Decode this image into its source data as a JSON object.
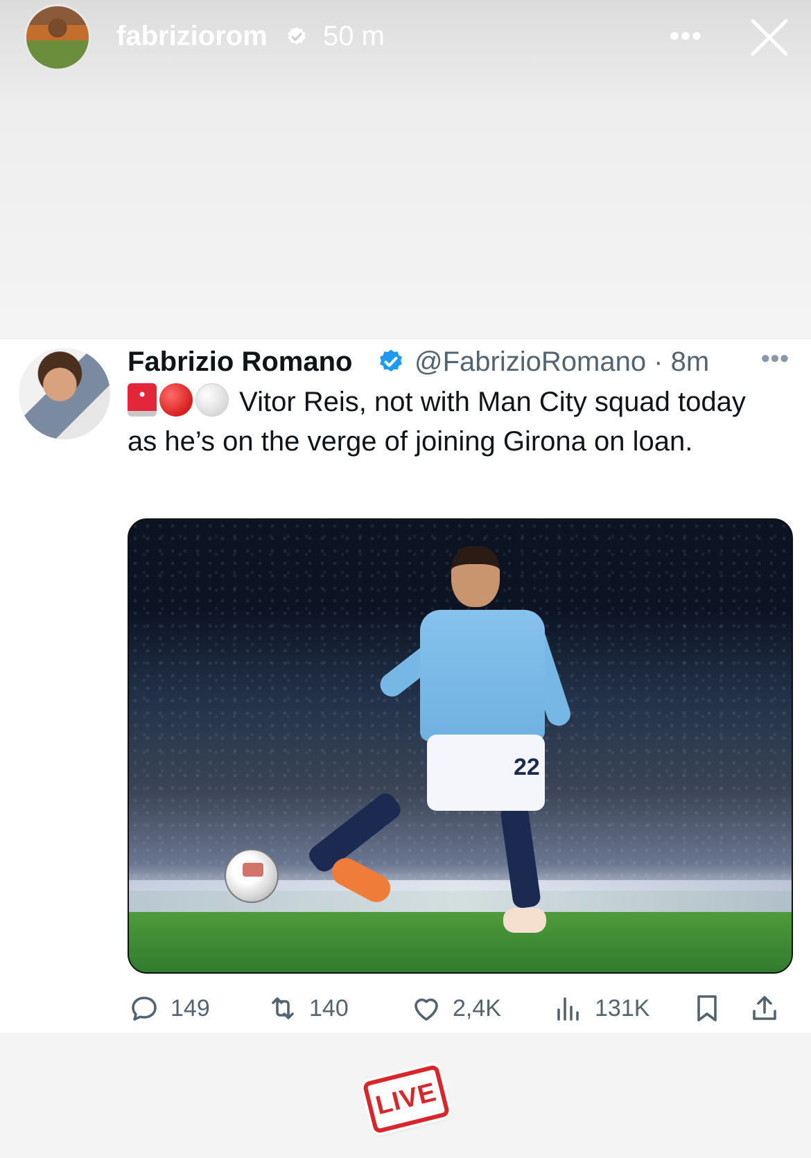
{
  "story": {
    "username": "fabriziorom",
    "time": "50 m",
    "more": "•••"
  },
  "tweet": {
    "author_name": "Fabrizio Romano",
    "handle_time": "@FabrizioRomano · 8m",
    "more": "•••",
    "text": "Vitor Reis, not with Man City squad today as he’s on the verge of joining Girona on loan.",
    "emojis": [
      "siren-emoji",
      "red-circle-emoji",
      "white-circle-emoji"
    ],
    "media": {
      "jersey_number": "22"
    },
    "actions": {
      "replies": "149",
      "reposts": "140",
      "likes": "2,4K",
      "views": "131K"
    }
  },
  "sticker": {
    "label": "LIVE"
  },
  "colors": {
    "verified_blue": "#1d9bf0",
    "action_gray": "#536471",
    "live_red": "#d8262b"
  }
}
